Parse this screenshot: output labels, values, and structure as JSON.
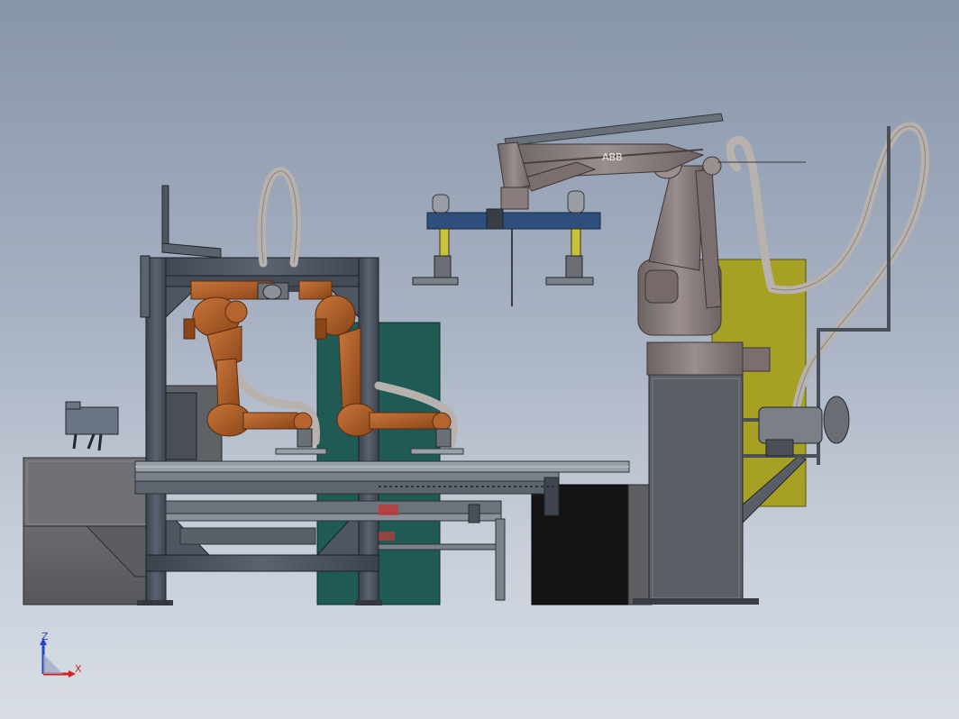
{
  "viewport": {
    "background_top": "#8795a9",
    "background_bottom": "#d8dde5"
  },
  "colors": {
    "frame_steel": "#4a5360",
    "frame_edge": "#2a3038",
    "robot_orange": "#b5642e",
    "robot_orange_dark": "#7a3e18",
    "palletizer_grey": "#8a7d7d",
    "palletizer_dark": "#5e5454",
    "teal_panel": "#1f5a55",
    "olive_panel": "#a6a024",
    "gripper_blue": "#2e4f7c",
    "gripper_yellow": "#c9c23a",
    "hose": "#b7b2ad",
    "cabinet_black": "#141414",
    "machine_grey": "#6c6e70",
    "axis_z": "#2244cc",
    "axis_x": "#cc2222"
  },
  "triad": {
    "z_label": "Z",
    "x_label": "X"
  },
  "robot_badge": {
    "text": "ABB"
  }
}
